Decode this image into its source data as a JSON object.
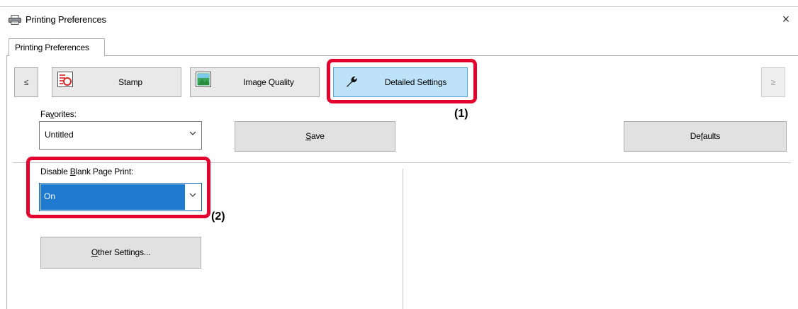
{
  "window": {
    "title": "Printing Preferences",
    "close_glyph": "×"
  },
  "outer_tabs": [
    {
      "label": "Printing Preferences"
    }
  ],
  "feature_tabs": {
    "prev_glyph": "≤",
    "next_glyph": "≥",
    "items": [
      {
        "label": "Stamp",
        "icon": "stamp-icon"
      },
      {
        "label": "Image Quality",
        "icon": "image-quality-icon"
      },
      {
        "label": "Detailed Settings",
        "icon": "wrench-icon",
        "selected": true
      }
    ]
  },
  "favorites": {
    "label": "Favorites:",
    "value": "Untitled",
    "save_label": "Save",
    "defaults_label": "Defaults"
  },
  "blank_page": {
    "label": "Disable Blank Page Print:",
    "value": "On"
  },
  "other_settings_label": "Other Settings...",
  "callouts": [
    "(1)",
    "(2)"
  ],
  "colors": {
    "callout_red": "#e4032e",
    "selected_tab": "#bee3f8",
    "selection_blue": "#1e7bcf"
  }
}
